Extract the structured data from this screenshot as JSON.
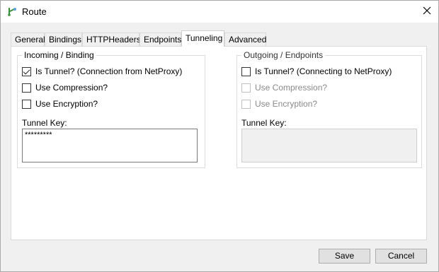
{
  "window": {
    "title": "Route",
    "close_glyph": "✕"
  },
  "tabs": [
    {
      "label": "General"
    },
    {
      "label": "Bindings"
    },
    {
      "label": "HTTPHeaders"
    },
    {
      "label": "Endpoints"
    },
    {
      "label": "Tunneling",
      "active": true
    },
    {
      "label": "Advanced"
    }
  ],
  "incoming": {
    "legend": "Incoming / Binding",
    "is_tunnel_label": "Is Tunnel? (Connection from NetProxy)",
    "is_tunnel_checked": true,
    "compression_label": "Use Compression?",
    "compression_checked": false,
    "encryption_label": "Use Encryption?",
    "encryption_checked": false,
    "key_label": "Tunnel Key:",
    "key_value": "*********"
  },
  "outgoing": {
    "legend": "Outgoing / Endpoints",
    "is_tunnel_label": "Is Tunnel? (Connecting to NetProxy)",
    "is_tunnel_checked": false,
    "compression_label": "Use Compression?",
    "encryption_label": "Use Encryption?",
    "key_label": "Tunnel Key:",
    "key_value": ""
  },
  "buttons": {
    "save": "Save",
    "cancel": "Cancel"
  },
  "colors": {
    "window_bg": "#f0f0f0",
    "panel_bg": "#ffffff",
    "disabled_text": "#8a8a8a"
  }
}
